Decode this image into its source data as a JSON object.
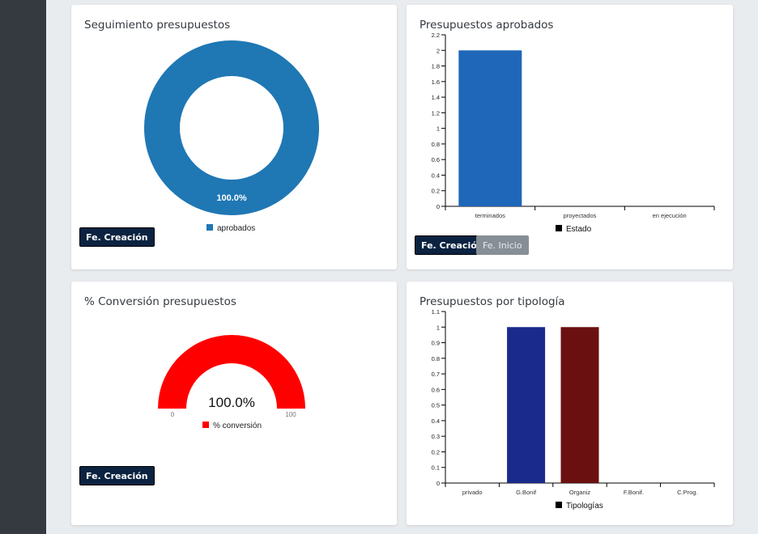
{
  "cards": {
    "seguimiento": {
      "title": "Seguimiento presupuestos",
      "chart_data": {
        "type": "pie",
        "labels": [
          "aprobados"
        ],
        "values": [
          100
        ],
        "slice_label": "100.0%",
        "colors": [
          "#1f77b4"
        ],
        "legend": "bottom"
      },
      "button": "Fe. Creación"
    },
    "aprobados": {
      "title": "Presupuestos aprobados",
      "chart_data": {
        "type": "bar",
        "categories": [
          "terminados",
          "proyectados",
          "en ejecución"
        ],
        "values": [
          2,
          0,
          0
        ],
        "series_name": "Estado",
        "color": "#1f67b8",
        "ylim": [
          0,
          2.2
        ],
        "yticks": [
          "0",
          "0.2",
          "0.4",
          "0.6",
          "0.8",
          "1",
          "1.2",
          "1.4",
          "1.6",
          "1.8",
          "2",
          "2.2"
        ],
        "legend": "bottom"
      },
      "buttons": [
        "Fe. Creación",
        "Fe. Inicio"
      ]
    },
    "conversion": {
      "title": "% Conversión presupuestos",
      "chart_data": {
        "type": "gauge",
        "value": 100,
        "value_label": "100.0%",
        "min_label": "0",
        "max_label": "100",
        "series_name": "% conversión",
        "color": "#ff0000"
      },
      "button": "Fe. Creación"
    },
    "tipologia": {
      "title": "Presupuestos por tipología",
      "chart_data": {
        "type": "bar",
        "categories": [
          "privado",
          "G.Bonif",
          "Organiz",
          "F.Bonif.",
          "C.Prog."
        ],
        "values": [
          0,
          1,
          1,
          0,
          0
        ],
        "colors": [
          "#1a2a8c",
          "#1a2a8c",
          "#6b1010",
          "#1a2a8c",
          "#1a2a8c"
        ],
        "series_name": "Tipologías",
        "ylim": [
          0,
          1.1
        ],
        "yticks": [
          "0",
          "0.1",
          "0.2",
          "0.3",
          "0.4",
          "0.5",
          "0.6",
          "0.7",
          "0.8",
          "0.9",
          "1",
          "1.1"
        ],
        "legend": "bottom"
      }
    }
  }
}
